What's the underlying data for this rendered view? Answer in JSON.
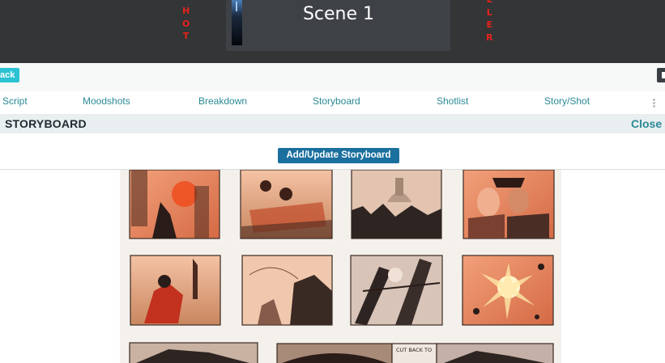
{
  "header": {
    "scene_title": "Scene 1",
    "left_vertical_letters": [
      "H",
      "O",
      "T"
    ],
    "right_vertical_letters": [
      "L",
      "L",
      "E",
      "R"
    ]
  },
  "actions": {
    "back_label": "ack"
  },
  "tabs": [
    {
      "label": "Script"
    },
    {
      "label": "Moodshots"
    },
    {
      "label": "Breakdown"
    },
    {
      "label": "Storyboard"
    },
    {
      "label": "Shotlist"
    },
    {
      "label": "Story/Shot"
    }
  ],
  "section": {
    "title": "STORYBOARD",
    "close_label": "Close"
  },
  "storyboard": {
    "add_button_label": "Add/Update Storyboard",
    "panel_caption": "CUT BACK TO"
  },
  "colors": {
    "header_bg": "#333536",
    "accent_red": "#e8221b",
    "tab_teal": "#2b8a96",
    "button_blue": "#1a6f9e",
    "back_cyan": "#2bc3d3"
  }
}
